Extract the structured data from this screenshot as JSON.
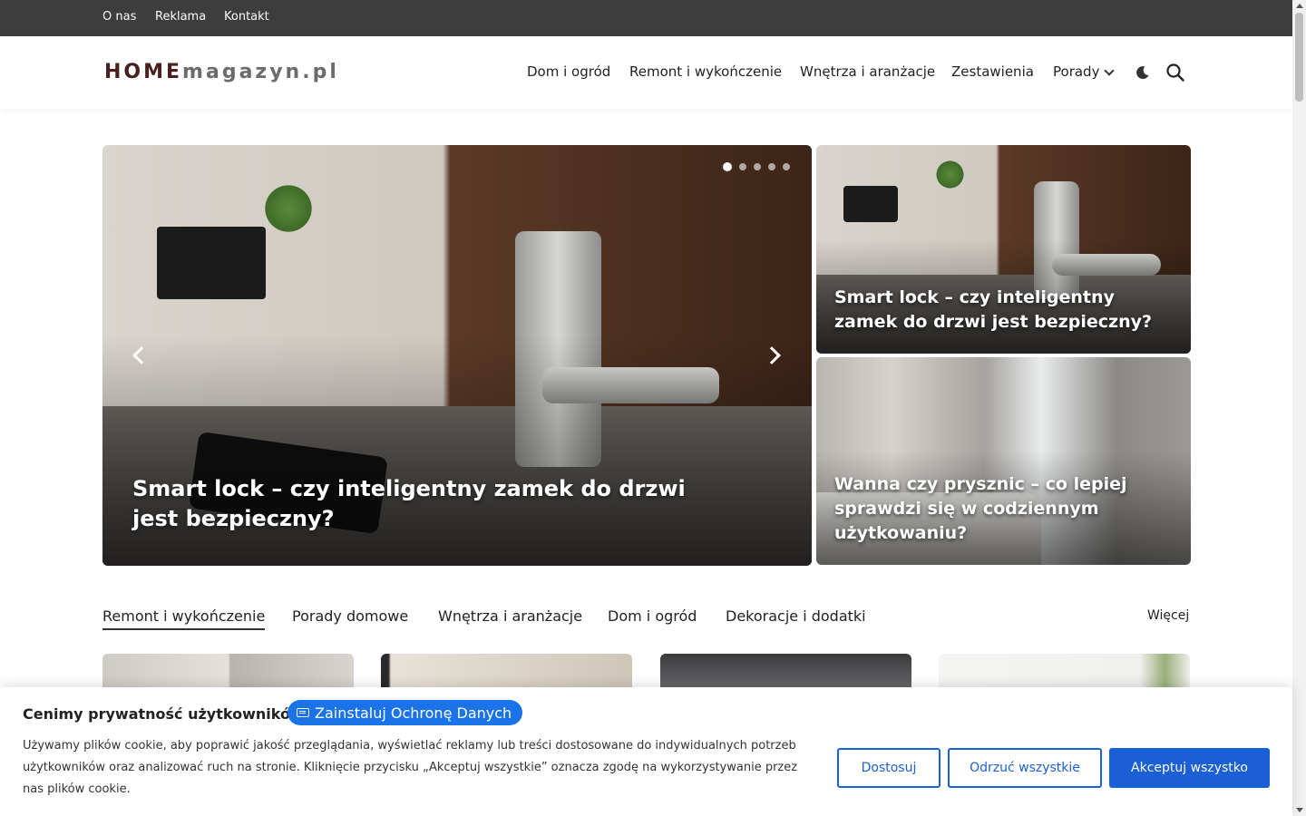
{
  "topbar": {
    "links": [
      "O nas",
      "Reklama",
      "Kontakt"
    ]
  },
  "header": {
    "logo": {
      "part1": "HOME",
      "part2": "magazyn.pl"
    },
    "nav": [
      "Dom i ogród",
      "Remont i wykończenie",
      "Wnętrza i aranżacje",
      "Zestawienia",
      "Porady"
    ],
    "icons": [
      "chevron-down-icon",
      "moon-icon",
      "search-icon"
    ]
  },
  "hero": {
    "title": "Smart lock – czy inteligentny zamek do drzwi jest bezpieczny?",
    "slides": 5,
    "active_slide": 1
  },
  "side_cards": [
    {
      "title": "Smart lock – czy inteligentny zamek do drzwi jest bezpieczny?"
    },
    {
      "title": "Wanna czy prysznic – co lepiej sprawdzi się w codziennym użytkowaniu?"
    }
  ],
  "tabs": {
    "items": [
      "Remont i wykończenie",
      "Porady domowe",
      "Wnętrza i aranżacje",
      "Dom i ogród",
      "Dekoracje i dodatki"
    ],
    "active": "Remont i wykończenie",
    "more": "Więcej"
  },
  "cookie": {
    "title": "Cenimy prywatność użytkowników",
    "install_button": "Zainstaluj Ochronę Danych",
    "text": "Używamy plików cookie, aby poprawić jakość przeglądania, wyświetlać reklamy lub treści dostosowane do indywidualnych potrzeb użytkowników oraz analizować ruch na stronie. Kliknięcie przycisku „Akceptuj wszystkie” oznacza zgodę na wykorzystywanie przez nas plików cookie.",
    "buttons": {
      "customize": "Dostosuj",
      "reject": "Odrzuć wszystkie",
      "accept": "Akceptuj wszystko"
    },
    "accent_color": "#1a5fd6"
  }
}
